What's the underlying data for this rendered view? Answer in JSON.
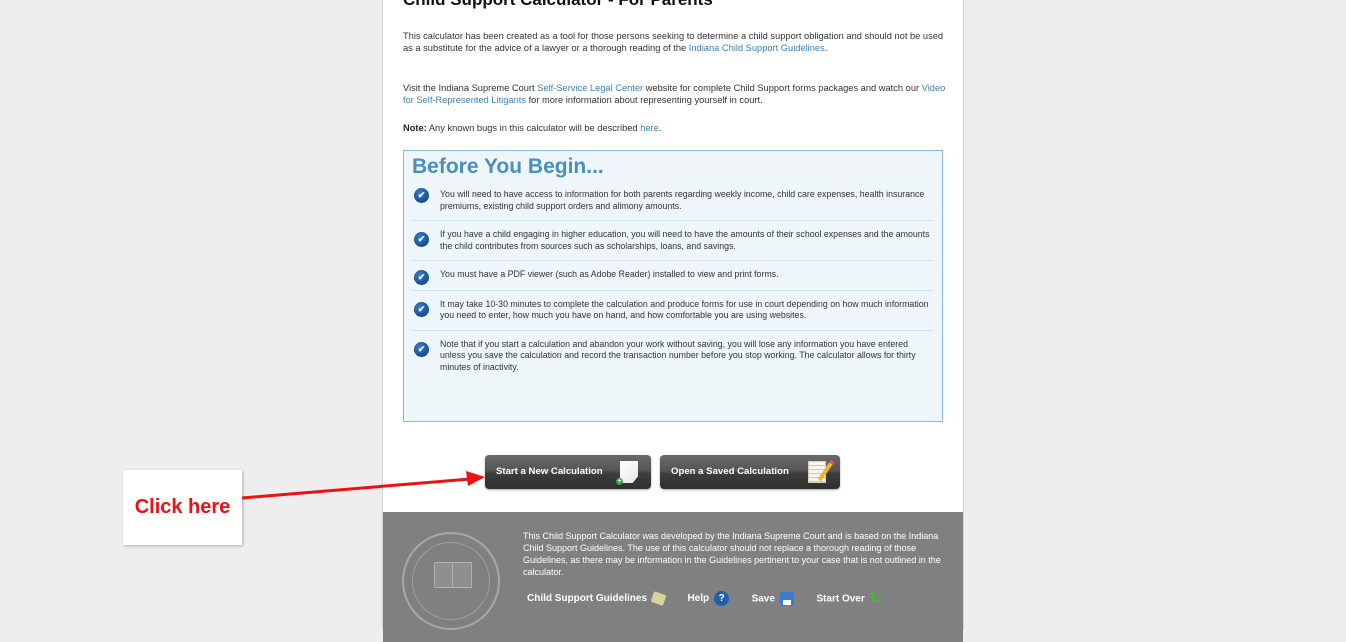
{
  "page": {
    "title": "Child Support Calculator - For Parents",
    "intro": {
      "text_before": "This calculator has been created as a tool for those persons seeking to determine a child support obligation and should not be used as a substitute for the advice of a lawyer or a thorough reading of the ",
      "link": "Indiana Child Support Guidelines",
      "text_after": "."
    },
    "visit": {
      "text1": "Visit the Indiana Supreme Court ",
      "link1": "Self-Service Legal Center",
      "text2": " website for complete Child Support forms packages and watch our ",
      "link2": "Video for Self-Represented Litigants",
      "text3": " for more information about representing yourself in court."
    },
    "note": {
      "label": "Note:",
      "text": " Any known bugs in this calculator will be described ",
      "link": "here",
      "text_after": "."
    }
  },
  "before_you_begin": {
    "heading": "Before You Begin...",
    "check_icon": "check-circle-icon",
    "items": [
      "You will need to have access to information for both parents regarding weekly income, child care expenses, health insurance premiums, existing child support orders and alimony amounts.",
      "If you have a child engaging in higher education, you will need to have the amounts of their school expenses and the amounts the child contributes from sources such as scholarships, loans, and savings.",
      "You must have a PDF viewer (such as Adobe Reader) installed to view and print forms.",
      "It may take 10-30 minutes to complete the calculation and produce forms for use in court depending on how much information you need to enter, how much you have on hand, and how comfortable you are using websites.",
      "Note that if you start a calculation and abandon your work without saving, you will lose any information you have entered unless you save the calculation and record the transaction number before you stop working. The calculator allows for thirty minutes of inactivity."
    ]
  },
  "buttons": {
    "start_new": "Start a New Calculation",
    "open_saved": "Open a  Saved Calculation"
  },
  "footer": {
    "text": "This Child Support Calculator was developed by the Indiana Supreme Court and is based on the Indiana Child Support Guidelines. The use of this calculator should not replace a thorough reading of those Guidelines, as there may be information in the Guidelines pertinent to your case that is not outlined in the calculator.",
    "links": {
      "guidelines": "Child Support Guidelines",
      "help": "Help",
      "save": "Save",
      "start_over": "Start Over"
    },
    "help_glyph": "?"
  },
  "annotation": {
    "callout": "Click here",
    "color": "#ee1111"
  }
}
